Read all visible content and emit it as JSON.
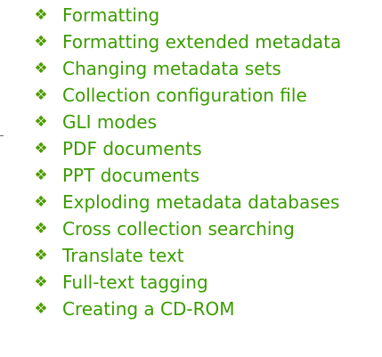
{
  "topics": [
    {
      "label": "Formatting"
    },
    {
      "label": "Formatting extended metadata"
    },
    {
      "label": "Changing metadata sets"
    },
    {
      "label": "Collection configuration file"
    },
    {
      "label": "GLI modes"
    },
    {
      "label": "PDF documents"
    },
    {
      "label": "PPT documents"
    },
    {
      "label": "Exploding metadata databases"
    },
    {
      "label": "Cross collection searching"
    },
    {
      "label": "Translate text"
    },
    {
      "label": "Full-text tagging"
    },
    {
      "label": "Creating a CD-ROM"
    }
  ],
  "bullet_glyph": "❖",
  "colors": {
    "link": "#3a9c00",
    "bullet": "#4e9b00"
  }
}
